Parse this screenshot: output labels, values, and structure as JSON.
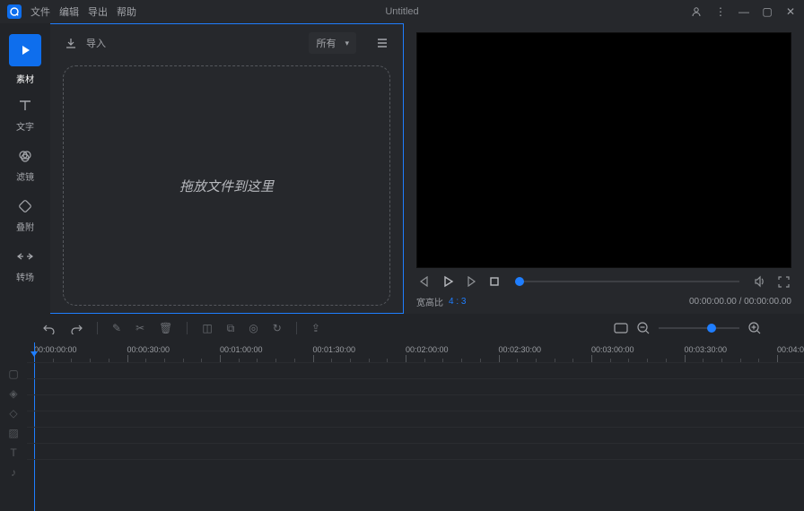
{
  "menu": {
    "file": "文件",
    "edit": "编辑",
    "export": "导出",
    "help": "帮助"
  },
  "window_title": "Untitled",
  "rail": {
    "material": "素材",
    "text": "文字",
    "filter": "滤镜",
    "overlay": "叠附",
    "transition": "转场"
  },
  "media": {
    "import_label": "导入",
    "filter_selected": "所有",
    "drop_hint": "拖放文件到这里"
  },
  "preview": {
    "aspect_label": "宽高比",
    "aspect_value": "4 : 3",
    "timecode": "00:00:00.00 / 00:00:00.00"
  },
  "timeline": {
    "marks": [
      "00:00:00:00",
      "00:00:30:00",
      "00:01:00:00",
      "00:01:30:00",
      "00:02:00:00",
      "00:02:30:00",
      "00:03:00:00",
      "00:03:30:00",
      "00:04:00:00"
    ]
  }
}
